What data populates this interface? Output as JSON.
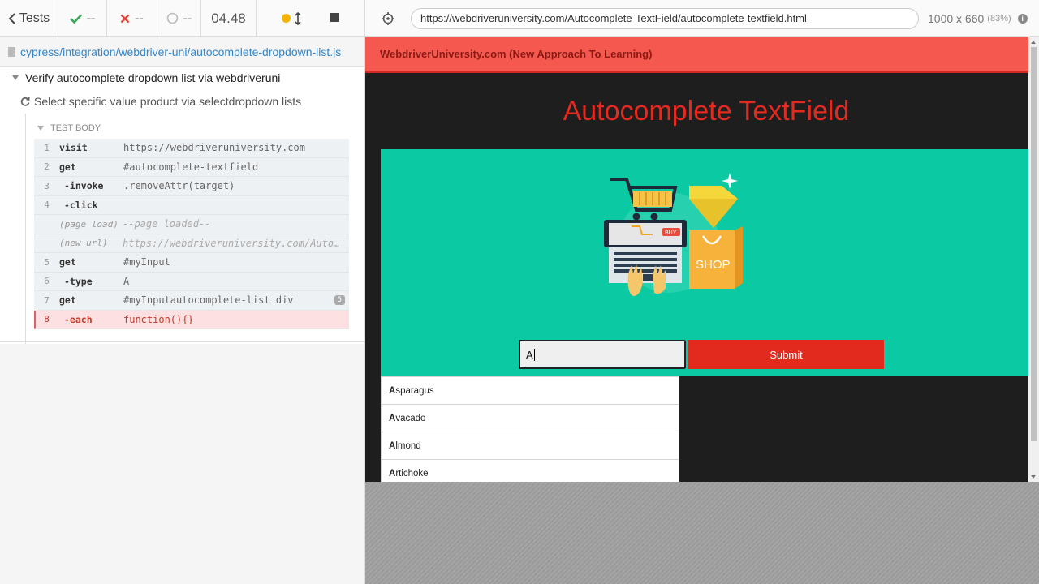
{
  "reporter": {
    "tests_label": "Tests",
    "passed": "--",
    "failed": "--",
    "pending": "--",
    "duration": "04.48"
  },
  "spec_path": "cypress/integration/webdriver-uni/autocomplete-dropdown-list.js",
  "suite_title": "Verify autocomplete dropdown list via webdriveruni",
  "test_title": "Select specific value product via selectdropdown lists",
  "test_body_label": "TEST BODY",
  "commands": [
    {
      "num": "1",
      "name": "visit",
      "msg": "https://webdriveruniversity.com"
    },
    {
      "num": "2",
      "name": "get",
      "msg": "#autocomplete-textfield"
    },
    {
      "num": "3",
      "name": "-invoke",
      "msg": ".removeAttr(target)"
    },
    {
      "num": "4",
      "name": "-click",
      "msg": ""
    },
    {
      "num": "",
      "name": "(page load)",
      "msg": "--page loaded--"
    },
    {
      "num": "",
      "name": "(new url)",
      "msg": "https://webdriveruniversity.com/Autocomplete-TextField/autocomplete-textfield.html"
    },
    {
      "num": "5",
      "name": "get",
      "msg": "#myInput"
    },
    {
      "num": "6",
      "name": "-type",
      "msg": "A"
    },
    {
      "num": "7",
      "name": "get",
      "msg": "#myInputautocomplete-list div",
      "badge": "5"
    },
    {
      "num": "8",
      "name": "-each",
      "msg": "function(){}"
    }
  ],
  "browser": {
    "url": "https://webdriveruniversity.com/Autocomplete-TextField/autocomplete-textfield.html",
    "viewport": "1000 x 660",
    "scale": "(83%)"
  },
  "site": {
    "nav_brand": "WebdriverUniversity.com (New Approach To Learning)",
    "heading": "Autocomplete TextField",
    "shop_text": "SHOP",
    "buy_text": "BUY",
    "input_value": "A",
    "submit_label": "Submit",
    "suggestions": [
      {
        "match": "A",
        "rest": "sparagus"
      },
      {
        "match": "A",
        "rest": "vacado"
      },
      {
        "match": "A",
        "rest": "lmond"
      },
      {
        "match": "A",
        "rest": "rtichoke"
      }
    ]
  },
  "colors": {
    "pass": "#3aa757",
    "fail": "#e0443a",
    "running": "#f8b400",
    "hero_bg": "#0bc9a3",
    "accent_red": "#e22a1f"
  },
  "icons": [
    "chevron-left-icon",
    "check-icon",
    "x-icon",
    "spinner-icon",
    "running-dot-icon",
    "resize-arrows-icon",
    "stop-icon",
    "crosshair-icon",
    "info-icon",
    "file-icon",
    "refresh-icon"
  ]
}
